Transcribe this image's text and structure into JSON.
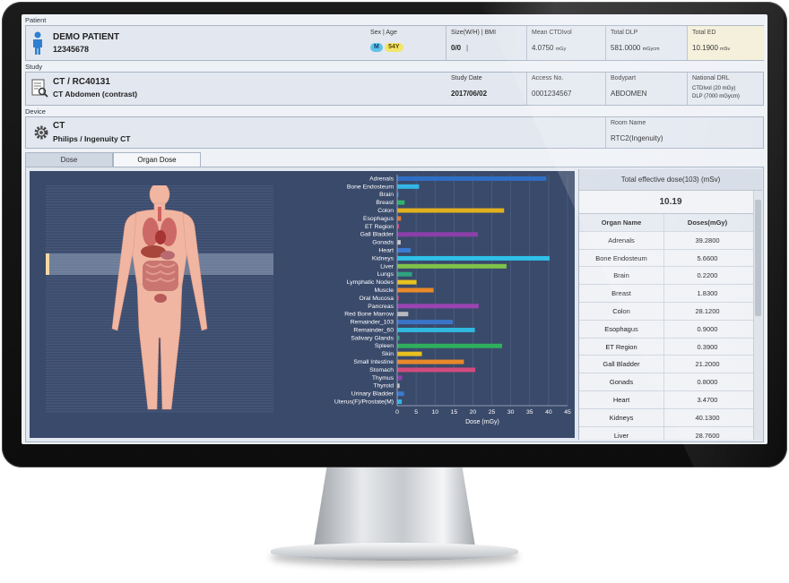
{
  "patient": {
    "section_label": "Patient",
    "name": "DEMO PATIENT",
    "id": "12345678",
    "sex_age_header": "Sex | Age",
    "sex": "M",
    "age": "54Y",
    "size_header": "Size(W/H) | BMI",
    "size_value": "0/0",
    "size_sep": "|",
    "ctdi_header": "Mean CTDIvol",
    "ctdi_value": "4.0750",
    "ctdi_unit": "mGy",
    "dlp_header": "Total DLP",
    "dlp_value": "581.0000",
    "dlp_unit": "mGycm",
    "ed_header": "Total ED",
    "ed_value": "10.1900",
    "ed_unit": "mSv"
  },
  "study": {
    "section_label": "Study",
    "title": "CT / RC40131",
    "description": "CT Abdomen (contrast)",
    "date_header": "Study Date",
    "date_value": "2017/06/02",
    "access_header": "Access No.",
    "access_value": "0001234567",
    "bodypart_header": "Bodypart",
    "bodypart_value": "ABDOMEN",
    "drl_header": "National DRL",
    "drl_line1": "CTDIvol (20 mGy)",
    "drl_line2": "DLP (7000 mGycm)"
  },
  "device": {
    "section_label": "Device",
    "type": "CT",
    "model": "Philips / Ingenuity CT",
    "room_header": "Room Name",
    "room_value": "RTC2(Ingenuity)"
  },
  "tabs": [
    {
      "label": "Dose",
      "active": false
    },
    {
      "label": "Organ Dose",
      "active": true
    }
  ],
  "summary": {
    "title": "Total effective dose(103) (mSv)",
    "value": "10.19",
    "col_organ": "Organ Name",
    "col_dose": "Doses(mGy)",
    "rows": [
      {
        "organ": "Adrenals",
        "dose": "39.2800"
      },
      {
        "organ": "Bone Endosteum",
        "dose": "5.6600"
      },
      {
        "organ": "Brain",
        "dose": "0.2200"
      },
      {
        "organ": "Breast",
        "dose": "1.8300"
      },
      {
        "organ": "Colon",
        "dose": "28.1200"
      },
      {
        "organ": "Esophagus",
        "dose": "0.9000"
      },
      {
        "organ": "ET Region",
        "dose": "0.3900"
      },
      {
        "organ": "Gall Bladder",
        "dose": "21.2000"
      },
      {
        "organ": "Gonads",
        "dose": "0.8000"
      },
      {
        "organ": "Heart",
        "dose": "3.4700"
      },
      {
        "organ": "Kidneys",
        "dose": "40.1300"
      },
      {
        "organ": "Liver",
        "dose": "28.7600"
      }
    ]
  },
  "chart_data": {
    "type": "bar",
    "orientation": "horizontal",
    "xlabel": "Dose (mGy)",
    "xlim": [
      0,
      45
    ],
    "xticks": [
      0,
      5,
      10,
      15,
      20,
      25,
      30,
      35,
      40,
      45
    ],
    "categories": [
      "Adrenals",
      "Bone Endosteum",
      "Brain",
      "Breast",
      "Colon",
      "Esophagus",
      "ET Region",
      "Gall Bladder",
      "Gonads",
      "Heart",
      "Kidneys",
      "Liver",
      "Lungs",
      "Lymphatic Nodes",
      "Muscle",
      "Oral Mucosa",
      "Pancreas",
      "Red Bone Marrow",
      "Remainder_103",
      "Remainder_60",
      "Salivary Glands",
      "Spleen",
      "Skin",
      "Small Intestine",
      "Stomach",
      "Thymus",
      "Thyroid",
      "Urinary Bladder",
      "Uterus(F)/Prostate(M)"
    ],
    "values": [
      39.28,
      5.66,
      0.22,
      1.83,
      28.12,
      0.9,
      0.39,
      21.2,
      0.8,
      3.47,
      40.13,
      28.76,
      3.8,
      5.0,
      9.5,
      0.3,
      21.4,
      2.8,
      14.6,
      20.4,
      0.5,
      27.6,
      6.4,
      17.5,
      20.5,
      1.2,
      0.5,
      1.7,
      1.1
    ],
    "colors": [
      "#2e6fc4",
      "#33b6e6",
      "#3a8fd8",
      "#2fb36b",
      "#e0b020",
      "#e07a2a",
      "#c94b7b",
      "#8b3fa8",
      "#c9c9c9",
      "#3a7ad0",
      "#2fc1e8",
      "#7fc24a",
      "#2fa37f",
      "#e8c21f",
      "#e88a2a",
      "#c4457c",
      "#9a44b3",
      "#b9b9c0",
      "#3a74c8",
      "#30b8e0",
      "#2f9f7a",
      "#2fae5c",
      "#e8c01f",
      "#e8892a",
      "#d24b7e",
      "#8f3fae",
      "#c9c9c9",
      "#3a7ad0",
      "#33b6e6"
    ]
  }
}
